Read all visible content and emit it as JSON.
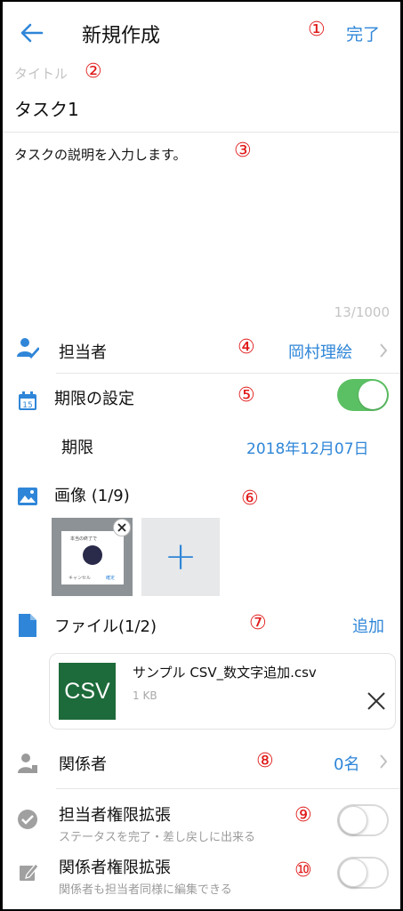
{
  "header": {
    "title": "新規作成",
    "done_label": "完了"
  },
  "markers": [
    "①",
    "②",
    "③",
    "④",
    "⑤",
    "⑥",
    "⑦",
    "⑧",
    "⑨",
    "⑩"
  ],
  "title_field": {
    "placeholder": "タイトル",
    "value": "タスク1"
  },
  "description": {
    "value": "タスクの説明を入力します。",
    "counter": "13/1000"
  },
  "assignee": {
    "label": "担当者",
    "value": "岡村理絵"
  },
  "deadline": {
    "label": "期限の設定",
    "enabled": true,
    "sub_label": "期限",
    "date": "2018年12月07日"
  },
  "images": {
    "label": "画像 (1/9)",
    "thumb_text": "本当の終了で",
    "thumb_cancel": "キャンセル",
    "thumb_ok": "確定",
    "add_glyph": "+"
  },
  "files": {
    "label": "ファイル(1/2)",
    "add_label": "追加",
    "items": [
      {
        "icon_text": "CSV",
        "name": "サンプル CSV_数文字追加.csv",
        "size": "1 KB"
      }
    ]
  },
  "related": {
    "label": "関係者",
    "value": "0名"
  },
  "assignee_permission": {
    "label": "担当者権限拡張",
    "description": "ステータスを完了・差し戻しに出来る",
    "enabled": false
  },
  "related_permission": {
    "label": "関係者権限拡張",
    "description": "関係者も担当者同様に編集できる",
    "enabled": false
  },
  "colors": {
    "accent": "#2f86d8",
    "marker": "#e01919",
    "toggle_on": "#5bc063",
    "csv_bg": "#1d6a3a"
  }
}
